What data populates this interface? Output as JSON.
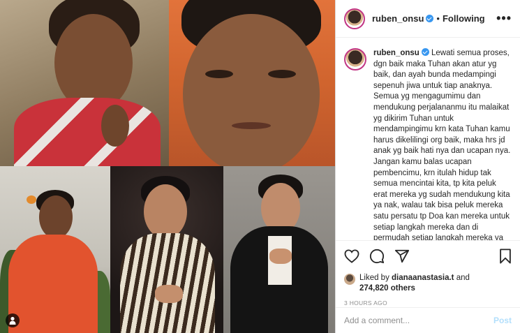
{
  "post": {
    "username": "ruben_onsu",
    "follow_status": "Following",
    "separator": "•",
    "more_label": "•••"
  },
  "caption": {
    "username": "ruben_onsu",
    "text": "Lewati semua proses, dgn baik maka Tuhan akan atur yg baik, dan ayah bunda medampingi sepenuh jiwa untuk tiap anaknya.\nSemua yg mengagumimu dan mendukung perjalananmu itu malaikat yg dikirim Tuhan untuk mendampingimu krn kata Tuhan kamu harus dikelilingi org baik, maka hrs jd anak yg baik hati nya dan ucapan nya.\nJangan kamu balas ucapan pembencimu, krn itulah hidup tak semua mencintai kita, tp kita peluk erat mereka yg sudah mendukung kita ya nak, walau tak bisa peluk mereka satu persatu tp Doa kan mereka untuk setiap langkah mereka dan di permudah setiap langkah mereka ya"
  },
  "likes": {
    "prefix": "Liked by ",
    "liker": "dianaanastasia.t",
    "conjunction": " and",
    "others": "274,820 others"
  },
  "timestamp": "3 HOURS AGO",
  "comment": {
    "placeholder": "Add a comment...",
    "post_label": "Post"
  },
  "icons": {
    "like": "heart-icon",
    "comment": "comment-icon",
    "share": "share-icon",
    "save": "bookmark-icon",
    "collage_user": "user-icon"
  },
  "colors": {
    "verified": "#3897f0",
    "post_disabled": "#b2dffc",
    "muted": "#8e8e8e"
  }
}
